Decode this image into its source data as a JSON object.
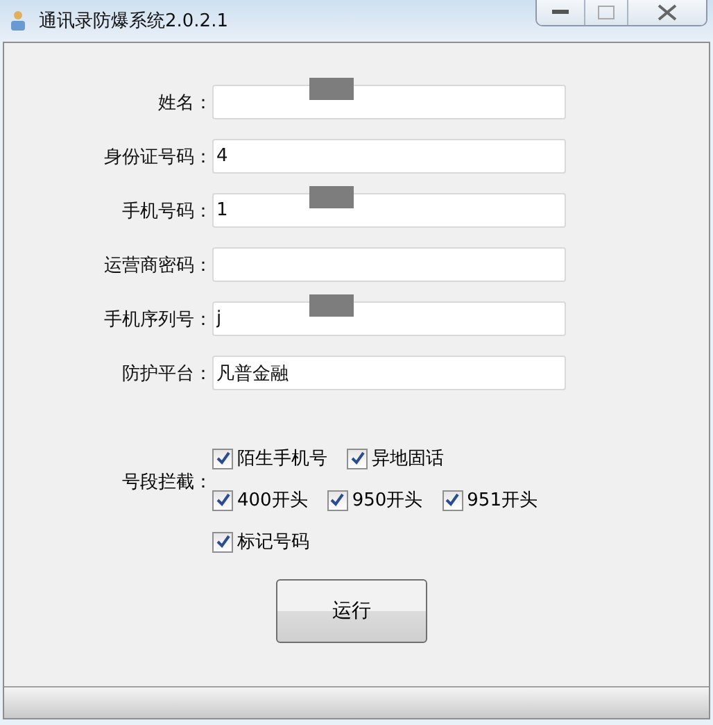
{
  "window": {
    "title": "通讯录防爆系统2.0.2.1"
  },
  "fields": [
    {
      "label": "姓名：",
      "redacted": true
    },
    {
      "label": "身份证号码：",
      "value": "4"
    },
    {
      "label": "手机号码：",
      "value": "1",
      "redacted": true
    },
    {
      "label": "运营商密码："
    },
    {
      "label": "手机序列号：",
      "value": "j",
      "redacted": true
    },
    {
      "label": "防护平台：",
      "value": "凡普金融"
    }
  ],
  "filter": {
    "label": "号段拦截：",
    "rows": [
      [
        {
          "label": "陌生手机号",
          "checked": true
        },
        {
          "label": "异地固话",
          "checked": true
        }
      ],
      [
        {
          "label": "400开头",
          "checked": true
        },
        {
          "label": "950开头",
          "checked": true
        },
        {
          "label": "951开头",
          "checked": true
        }
      ],
      [
        {
          "label": "标记号码",
          "checked": true
        }
      ]
    ]
  },
  "button": "运行"
}
